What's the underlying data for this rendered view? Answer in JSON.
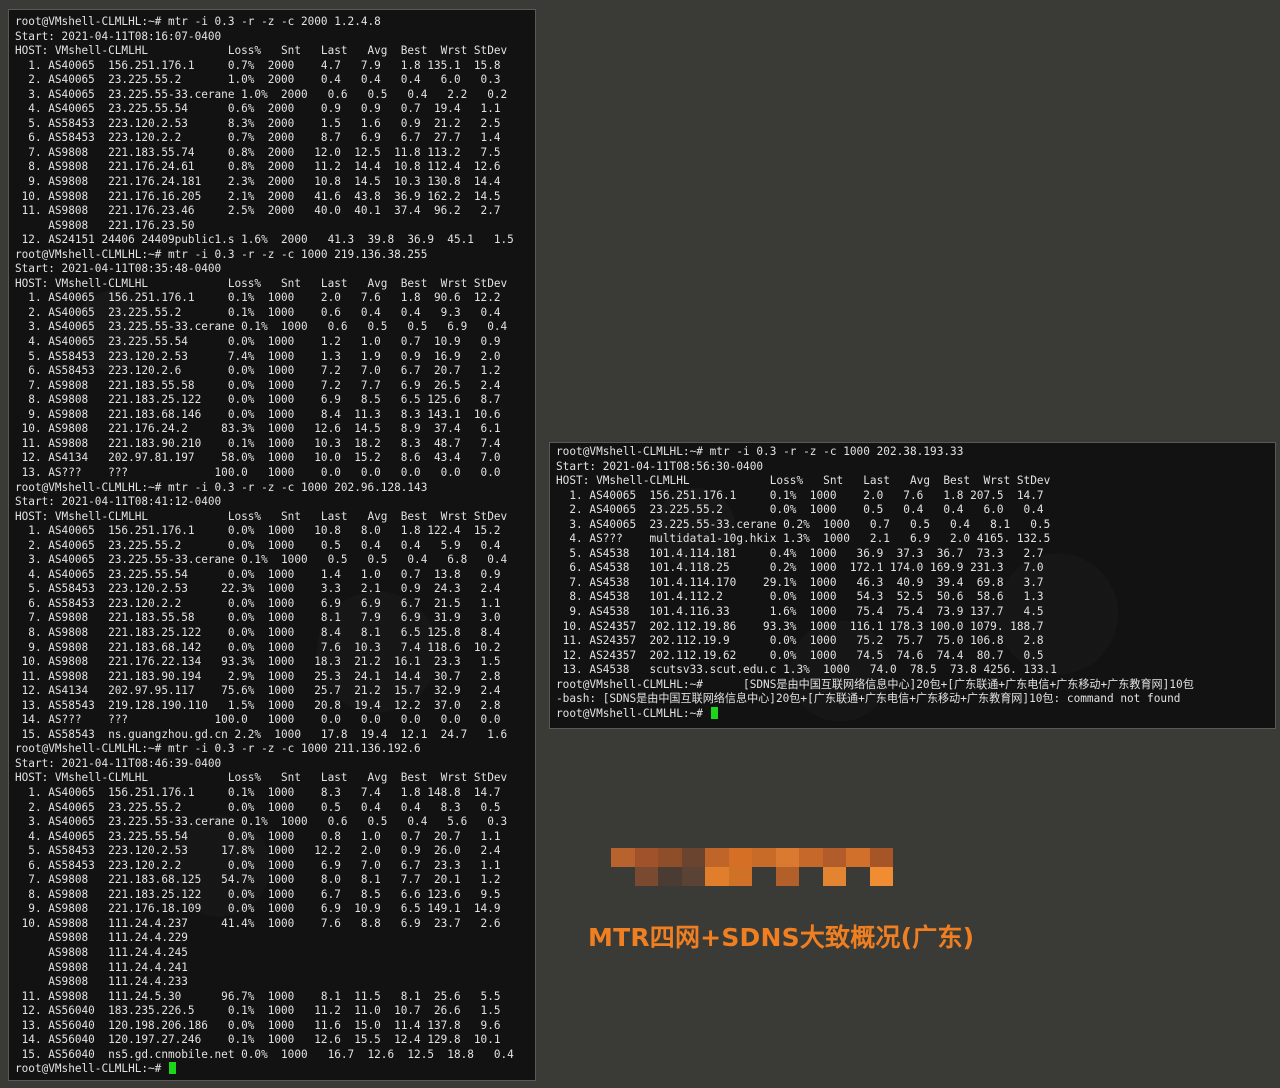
{
  "left_terminal": {
    "lines": [
      "root@VMshell-CLMLHL:~# mtr -i 0.3 -r -z -c 2000 1.2.4.8",
      "Start: 2021-04-11T08:16:07-0400",
      "HOST: VMshell-CLMLHL            Loss%   Snt   Last   Avg  Best  Wrst StDev",
      "  1. AS40065  156.251.176.1     0.7%  2000    4.7   7.9   1.8 135.1  15.8",
      "  2. AS40065  23.225.55.2       1.0%  2000    0.4   0.4   0.4   6.0   0.3",
      "  3. AS40065  23.225.55-33.cerane 1.0%  2000   0.6   0.5   0.4   2.2   0.2",
      "  4. AS40065  23.225.55.54      0.6%  2000    0.9   0.9   0.7  19.4   1.1",
      "  5. AS58453  223.120.2.53      8.3%  2000    1.5   1.6   0.9  21.2   2.5",
      "  6. AS58453  223.120.2.2       0.7%  2000    8.7   6.9   6.7  27.7   1.4",
      "  7. AS9808   221.183.55.74     0.8%  2000   12.0  12.5  11.8 113.2   7.5",
      "  8. AS9808   221.176.24.61     0.8%  2000   11.2  14.4  10.8 112.4  12.6",
      "  9. AS9808   221.176.24.181    2.3%  2000   10.8  14.5  10.3 130.8  14.4",
      " 10. AS9808   221.176.16.205    2.1%  2000   41.6  43.8  36.9 162.2  14.5",
      " 11. AS9808   221.176.23.46     2.5%  2000   40.0  40.1  37.4  96.2   2.7",
      "     AS9808   221.176.23.50",
      " 12. AS24151 24406 24409public1.s 1.6%  2000   41.3  39.8  36.9  45.1   1.5",
      "root@VMshell-CLMLHL:~# mtr -i 0.3 -r -z -c 1000 219.136.38.255",
      "Start: 2021-04-11T08:35:48-0400",
      "HOST: VMshell-CLMLHL            Loss%   Snt   Last   Avg  Best  Wrst StDev",
      "  1. AS40065  156.251.176.1     0.1%  1000    2.0   7.6   1.8  90.6  12.2",
      "  2. AS40065  23.225.55.2       0.1%  1000    0.6   0.4   0.4   9.3   0.4",
      "  3. AS40065  23.225.55-33.cerane 0.1%  1000   0.6   0.5   0.5   6.9   0.4",
      "  4. AS40065  23.225.55.54      0.0%  1000    1.2   1.0   0.7  10.9   0.9",
      "  5. AS58453  223.120.2.53      7.4%  1000    1.3   1.9   0.9  16.9   2.0",
      "  6. AS58453  223.120.2.6       0.0%  1000    7.2   7.0   6.7  20.7   1.2",
      "  7. AS9808   221.183.55.58     0.0%  1000    7.2   7.7   6.9  26.5   2.4",
      "  8. AS9808   221.183.25.122    0.0%  1000    6.9   8.5   6.5 125.6   8.7",
      "  9. AS9808   221.183.68.146    0.0%  1000    8.4  11.3   8.3 143.1  10.6",
      " 10. AS9808   221.176.24.2     83.3%  1000   12.6  14.5   8.9  37.4   6.1",
      " 11. AS9808   221.183.90.210    0.1%  1000   10.3  18.2   8.3  48.7   7.4",
      " 12. AS4134   202.97.81.197    58.0%  1000   10.0  15.2   8.6  43.4   7.0",
      " 13. AS???    ???             100.0   1000    0.0   0.0   0.0   0.0   0.0",
      "root@VMshell-CLMLHL:~# mtr -i 0.3 -r -z -c 1000 202.96.128.143",
      "Start: 2021-04-11T08:41:12-0400",
      "HOST: VMshell-CLMLHL            Loss%   Snt   Last   Avg  Best  Wrst StDev",
      "  1. AS40065  156.251.176.1     0.0%  1000   10.8   8.0   1.8 122.4  15.2",
      "  2. AS40065  23.225.55.2       0.0%  1000    0.5   0.4   0.4   5.9   0.4",
      "  3. AS40065  23.225.55-33.cerane 0.1%  1000   0.5   0.5   0.4   6.8   0.4",
      "  4. AS40065  23.225.55.54      0.0%  1000    1.4   1.0   0.7  13.8   0.9",
      "  5. AS58453  223.120.2.53     22.3%  1000    3.3   2.1   0.9  24.3   2.4",
      "  6. AS58453  223.120.2.2       0.0%  1000    6.9   6.9   6.7  21.5   1.1",
      "  7. AS9808   221.183.55.58     0.0%  1000    8.1   7.9   6.9  31.9   3.0",
      "  8. AS9808   221.183.25.122    0.0%  1000    8.4   8.1   6.5 125.8   8.4",
      "  9. AS9808   221.183.68.142    0.0%  1000    7.6  10.3   7.4 118.6  10.2",
      " 10. AS9808   221.176.22.134   93.3%  1000   18.3  21.2  16.1  23.3   1.5",
      " 11. AS9808   221.183.90.194    2.9%  1000   25.3  24.1  14.4  30.7   2.8",
      " 12. AS4134   202.97.95.117    75.6%  1000   25.7  21.2  15.7  32.9   2.4",
      " 13. AS58543  219.128.190.110   1.5%  1000   20.8  19.4  12.2  37.0   2.8",
      " 14. AS???    ???             100.0   1000    0.0   0.0   0.0   0.0   0.0",
      " 15. AS58543  ns.guangzhou.gd.cn 2.2%  1000   17.8  19.4  12.1  24.7   1.6",
      "root@VMshell-CLMLHL:~# mtr -i 0.3 -r -z -c 1000 211.136.192.6",
      "Start: 2021-04-11T08:46:39-0400",
      "HOST: VMshell-CLMLHL            Loss%   Snt   Last   Avg  Best  Wrst StDev",
      "  1. AS40065  156.251.176.1     0.1%  1000    8.3   7.4   1.8 148.8  14.7",
      "  2. AS40065  23.225.55.2       0.0%  1000    0.5   0.4   0.4   8.3   0.5",
      "  3. AS40065  23.225.55-33.cerane 0.1%  1000   0.6   0.5   0.4   5.6   0.3",
      "  4. AS40065  23.225.55.54      0.0%  1000    0.8   1.0   0.7  20.7   1.1",
      "  5. AS58453  223.120.2.53     17.8%  1000   12.2   2.0   0.9  26.0   2.4",
      "  6. AS58453  223.120.2.2       0.0%  1000    6.9   7.0   6.7  23.3   1.1",
      "  7. AS9808   221.183.68.125   54.7%  1000    8.0   8.1   7.7  20.1   1.2",
      "  8. AS9808   221.183.25.122    0.0%  1000    6.7   8.5   6.6 123.6   9.5",
      "  9. AS9808   221.176.18.109    0.0%  1000    6.9  10.9   6.5 149.1  14.9",
      " 10. AS9808   111.24.4.237     41.4%  1000    7.6   8.8   6.9  23.7   2.6",
      "     AS9808   111.24.4.229",
      "     AS9808   111.24.4.245",
      "     AS9808   111.24.4.241",
      "     AS9808   111.24.4.233",
      " 11. AS9808   111.24.5.30      96.7%  1000    8.1  11.5   8.1  25.6   5.5",
      " 12. AS56040  183.235.226.5     0.1%  1000   11.2  11.0  10.7  26.6   1.5",
      " 13. AS56040  120.198.206.186   0.0%  1000   11.6  15.0  11.4 137.8   9.6",
      " 14. AS56040  120.197.27.246    0.1%  1000   12.6  15.5  12.4 129.8  10.1",
      " 15. AS56040  ns5.gd.cnmobile.net 0.0%  1000   16.7  12.6  12.5  18.8   0.4",
      "root@VMshell-CLMLHL:~# "
    ]
  },
  "right_terminal": {
    "lines": [
      "root@VMshell-CLMLHL:~# mtr -i 0.3 -r -z -c 1000 202.38.193.33",
      "Start: 2021-04-11T08:56:30-0400",
      "HOST: VMshell-CLMLHL            Loss%   Snt   Last   Avg  Best  Wrst StDev",
      "  1. AS40065  156.251.176.1     0.1%  1000    2.0   7.6   1.8 207.5  14.7",
      "  2. AS40065  23.225.55.2       0.0%  1000    0.5   0.4   0.4   6.0   0.4",
      "  3. AS40065  23.225.55-33.cerane 0.2%  1000   0.7   0.5   0.4   8.1   0.5",
      "  4. AS???    multidata1-10g.hkix 1.3%  1000   2.1   6.9   2.0 4165. 132.5",
      "  5. AS4538   101.4.114.181     0.4%  1000   36.9  37.3  36.7  73.3   2.7",
      "  6. AS4538   101.4.118.25      0.2%  1000  172.1 174.0 169.9 231.3   7.0",
      "  7. AS4538   101.4.114.170    29.1%  1000   46.3  40.9  39.4  69.8   3.7",
      "  8. AS4538   101.4.112.2       0.0%  1000   54.3  52.5  50.6  58.6   1.3",
      "  9. AS4538   101.4.116.33      1.6%  1000   75.4  75.4  73.9 137.7   4.5",
      " 10. AS24357  202.112.19.86    93.3%  1000  116.1 178.3 100.0 1079. 188.7",
      " 11. AS24357  202.112.19.9      0.0%  1000   75.2  75.7  75.0 106.8   2.8",
      " 12. AS24357  202.112.19.62     0.0%  1000   74.5  74.6  74.4  80.7   0.5",
      " 13. AS4538   scutsv33.scut.edu.c 1.3%  1000   74.0  78.5  73.8 4256. 133.1",
      "root@VMshell-CLMLHL:~#      [SDNS是由中国互联网络信息中心]20包+[广东联通+广东电信+广东移动+广东教育网]10包",
      "-bash: [SDNS是由中国互联网络信息中心]20包+[广东联通+广东电信+广东移动+广东教育网]10包: command not found",
      "root@VMshell-CLMLHL:~# "
    ]
  },
  "caption": "MTR四网+SDNS大致概况(广东)",
  "colors": {
    "page_background": "#3a3a36",
    "terminal_background": "#121212",
    "terminal_text": "#e2e2e2",
    "cursor": "#1bd61b",
    "caption": "#f07f22"
  },
  "mosaic_rows": [
    [
      "#b8632e",
      "#a0522a",
      "#8f4e2a",
      "#6b4430",
      "#c0652a",
      "#d56f25",
      "#c86a28",
      "#d97a30",
      "#c5682a",
      "#b15c2a",
      "#d0702a",
      "#a65528"
    ],
    [
      "#3a3a36",
      "#7a4a30",
      "#4a3c32",
      "#5a4234",
      "#e07e2c",
      "#cf7228",
      "#3a3a36",
      "#b25f2a",
      "#3a3a36",
      "#e38530",
      "#3a3a36",
      "#f08d33"
    ]
  ]
}
